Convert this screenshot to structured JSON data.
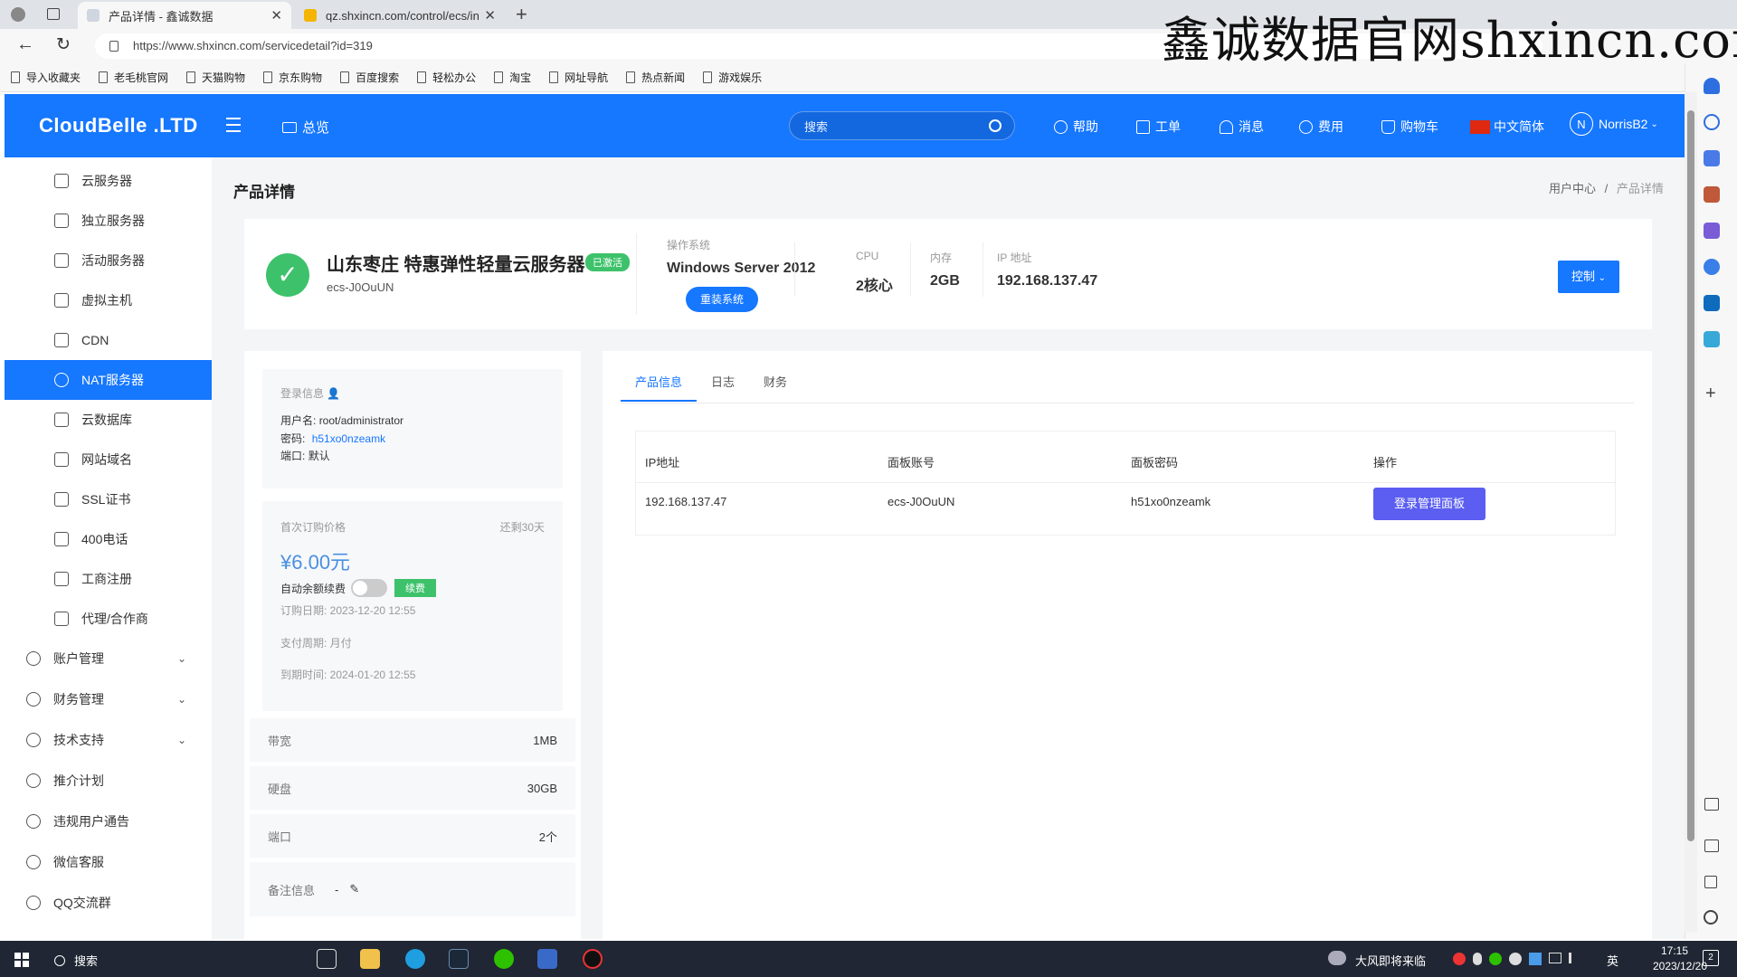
{
  "browser": {
    "tabs": [
      {
        "title": "产品详情 - 鑫诚数据"
      },
      {
        "title": "qz.shxincn.com/control/ecs/inde"
      }
    ],
    "url": "https://www.shxincn.com/servicedetail?id=319",
    "bookmarks": [
      "导入收藏夹",
      "老毛桃官网",
      "天猫购物",
      "京东购物",
      "百度搜索",
      "轻松办公",
      "淘宝",
      "网址导航",
      "热点新闻",
      "游戏娱乐"
    ]
  },
  "watermark": "鑫诚数据官网shxincn.com",
  "header": {
    "logo": "CloudBelle .LTD",
    "overview": "总览",
    "search_placeholder": "搜索",
    "nav": [
      "帮助",
      "工单",
      "消息",
      "费用",
      "购物车",
      "中文简体"
    ],
    "user": "NorrisB2",
    "avatar_letter": "N"
  },
  "sidebar": {
    "items": [
      "云服务器",
      "独立服务器",
      "活动服务器",
      "虚拟主机",
      "CDN",
      "NAT服务器",
      "云数据库",
      "网站域名",
      "SSL证书",
      "400电话",
      "工商注册",
      "代理/合作商"
    ],
    "groups": [
      "账户管理",
      "财务管理",
      "技术支持",
      "推介计划",
      "违规用户通告",
      "微信客服",
      "QQ交流群"
    ],
    "active": "NAT服务器"
  },
  "page": {
    "title": "产品详情",
    "breadcrumb": [
      "用户中心",
      "产品详情"
    ],
    "breadcrumb_sep": "/"
  },
  "product": {
    "name": "山东枣庄 特惠弹性轻量云服务器",
    "badge": "已激活",
    "id": "ecs-J0OuUN",
    "os_label": "操作系统",
    "os": "Windows Server 2012",
    "reinstall": "重装系统",
    "cpu_label": "CPU",
    "cpu": "2核心",
    "mem_label": "内存",
    "mem": "2GB",
    "ip_label": "IP 地址",
    "ip": "192.168.137.47",
    "control": "控制"
  },
  "login_info": {
    "title": "登录信息",
    "user_label": "用户名:",
    "user": "root/administrator",
    "pass_label": "密码:",
    "pass": "h51xo0nzeamk",
    "port_label": "端口:",
    "port": "默认"
  },
  "billing": {
    "price_label": "首次订购价格",
    "remaining": "还剩30天",
    "price": "¥6.00元",
    "auto_renew": "自动余额续费",
    "renew_btn": "续费",
    "order_date": "订购日期: 2023-12-20 12:55",
    "cycle": "支付周期: 月付",
    "expire": "到期时间: 2024-01-20 12:55"
  },
  "specs": [
    {
      "label": "带宽",
      "value": "1MB"
    },
    {
      "label": "硬盘",
      "value": "30GB"
    },
    {
      "label": "端口",
      "value": "2个"
    },
    {
      "label": "备注信息",
      "value": "-"
    }
  ],
  "tabs": [
    "产品信息",
    "日志",
    "财务"
  ],
  "table": {
    "headers": [
      "IP地址",
      "面板账号",
      "面板密码",
      "操作"
    ],
    "row": [
      "192.168.137.47",
      "ecs-J0OuUN",
      "h51xo0nzeamk"
    ],
    "action": "登录管理面板"
  },
  "taskbar": {
    "search": "搜索",
    "weather": "大风即将来临",
    "ime": "英",
    "time": "17:15",
    "date": "2023/12/20",
    "notif_count": "2"
  },
  "colors": {
    "primary": "#1677ff",
    "success": "#3dc26b",
    "action": "#5b5ef0"
  }
}
